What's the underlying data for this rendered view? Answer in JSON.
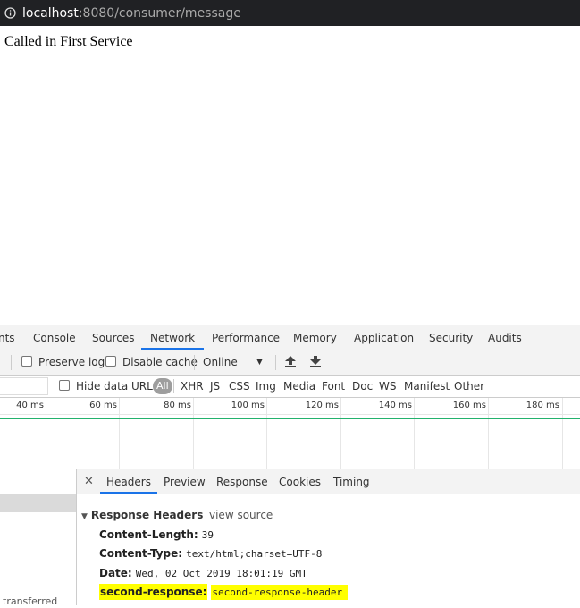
{
  "address_bar": {
    "host": "localhost",
    "rest": ":8080/consumer/message"
  },
  "page": {
    "text": "Called in First Service"
  },
  "devtools": {
    "tabs": [
      {
        "label": "nts"
      },
      {
        "label": "Console"
      },
      {
        "label": "Sources"
      },
      {
        "label": "Network"
      },
      {
        "label": "Performance"
      },
      {
        "label": "Memory"
      },
      {
        "label": "Application"
      },
      {
        "label": "Security"
      },
      {
        "label": "Audits"
      }
    ],
    "active_tab": "Network",
    "toolbar": {
      "preserve_log": "Preserve log",
      "disable_cache": "Disable cache",
      "throttle": "Online"
    },
    "filter": {
      "hide_data_urls": "Hide data URLs",
      "types": [
        "All",
        "XHR",
        "JS",
        "CSS",
        "Img",
        "Media",
        "Font",
        "Doc",
        "WS",
        "Manifest",
        "Other"
      ]
    },
    "timeline_ticks": [
      "40 ms",
      "60 ms",
      "80 ms",
      "100 ms",
      "120 ms",
      "140 ms",
      "160 ms",
      "180 ms"
    ],
    "left_footer": "transferred",
    "detail_tabs": [
      "Headers",
      "Preview",
      "Response",
      "Cookies",
      "Timing"
    ],
    "active_detail_tab": "Headers",
    "response_headers": {
      "title": "Response Headers",
      "view_source": "view source",
      "rows": [
        {
          "name": "Content-Length:",
          "value": "39"
        },
        {
          "name": "Content-Type:",
          "value": "text/html;charset=UTF-8"
        },
        {
          "name": "Date:",
          "value": "Wed, 02 Oct 2019 18:01:19 GMT"
        },
        {
          "name": "second-response:",
          "value": "second-response-header"
        }
      ]
    },
    "colors": {
      "accent": "#1a73e8",
      "highlight": "#ffff00",
      "timeline_green": "#23b26d"
    }
  }
}
